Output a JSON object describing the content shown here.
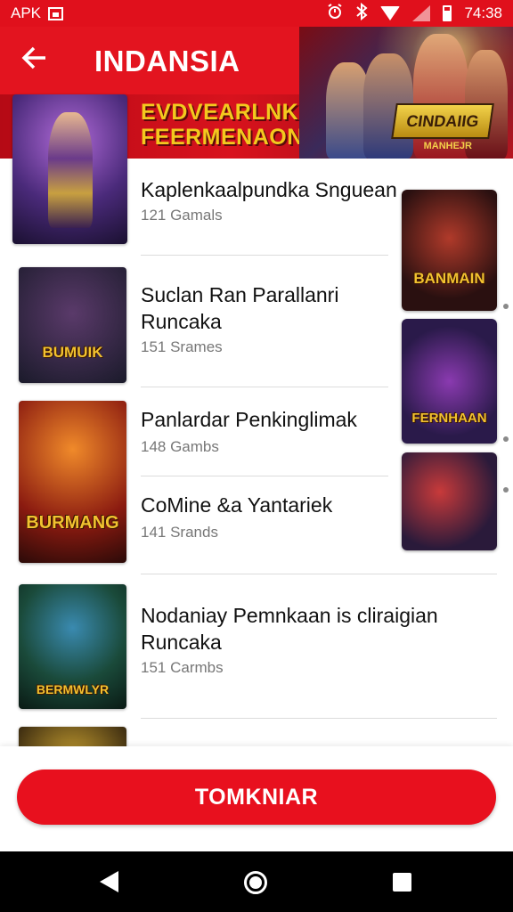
{
  "status_bar": {
    "left_text": "APK",
    "time": "74:38",
    "icons": [
      "photo-icon",
      "alarm-icon",
      "bluetooth-icon",
      "wifi-icon",
      "signal-icon",
      "battery-icon"
    ]
  },
  "header": {
    "back_icon": "arrow-left-icon",
    "title": "INDANSIA",
    "banner_line1": "EVDVEARLNKAN",
    "banner_line2": "FEERMENAON",
    "logo_line1": "CINDAIIG",
    "logo_line2": "MANHEJR"
  },
  "colors": {
    "brand_red": "#e3141f",
    "button_red": "#e8101e",
    "banner_gold": "#f3c91e"
  },
  "list": [
    {
      "title": "Kaplenkaalpundka Snguean",
      "subtitle": "121 Gamals",
      "art_text": ""
    },
    {
      "title": "Suclan Ran Parallanri Runcaka",
      "subtitle": "151 Srames",
      "art_text": "BUMUIK"
    },
    {
      "title": "Panlardar Penkinglimak",
      "subtitle": "148 Gambs",
      "art_text": "BURMANG"
    },
    {
      "title": "CoMine &a Yantariek",
      "subtitle": "141 Srands",
      "art_text": ""
    },
    {
      "title": "Nodaniay Pemnkaan is cliraigian Runcaka",
      "subtitle": "151 Carmbs",
      "art_text": "BERMWLYR"
    }
  ],
  "side_cards": [
    {
      "art_text": "BANMAIN"
    },
    {
      "art_text": "FERNHAAN"
    },
    {
      "art_text": ""
    }
  ],
  "bottom_button": {
    "label": "TOMKNIAR"
  },
  "nav": {
    "back_icon": "nav-back-icon",
    "home_icon": "nav-home-icon",
    "recent_icon": "nav-recent-icon"
  }
}
